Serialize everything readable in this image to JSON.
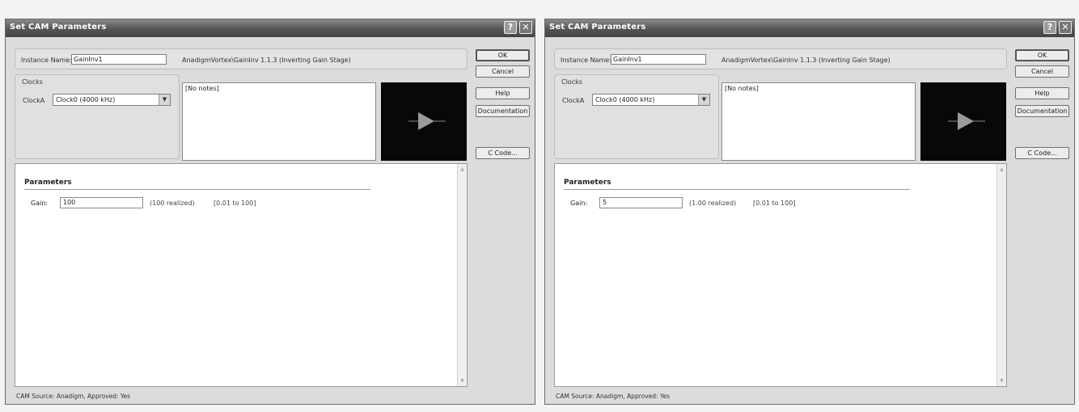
{
  "dialogs": [
    {
      "title": "Set CAM Parameters",
      "title_help": "?",
      "title_close": "✕",
      "instance_label": "Instance Name:",
      "instance_value": "GainInv1",
      "module_info": "AnadigmVortex\\GainInv 1.1.3 (Inverting Gain Stage)",
      "clocks_title": "Clocks",
      "clock_label": "ClockA",
      "clock_value": "Clock0 (4000 kHz)",
      "notes": "[No notes]",
      "buttons": {
        "ok": "OK",
        "cancel": "Cancel",
        "help": "Help",
        "documentation": "Documentation",
        "ccode": "C Code..."
      },
      "params_heading": "Parameters",
      "gain_label": "Gain:",
      "gain_value": "100",
      "gain_realized": "(100 realized)",
      "gain_range": "[0.01 to 100]",
      "status": "CAM Source: Anadigm, Approved: Yes",
      "preview_icon": "triangle-amplifier-icon"
    },
    {
      "title": "Set CAM Parameters",
      "title_help": "?",
      "title_close": "✕",
      "instance_label": "Instance Name:",
      "instance_value": "GainInv1",
      "module_info": "AnadigmVortex\\GainInv 1.1.3 (Inverting Gain Stage)",
      "clocks_title": "Clocks",
      "clock_label": "ClockA",
      "clock_value": "Clock0 (4000 kHz)",
      "notes": "[No notes]",
      "buttons": {
        "ok": "OK",
        "cancel": "Cancel",
        "help": "Help",
        "documentation": "Documentation",
        "ccode": "C Code..."
      },
      "params_heading": "Parameters",
      "gain_label": "Gain:",
      "gain_value": "5",
      "gain_realized": "(1.00 realized)",
      "gain_range": "[0.01 to 100]",
      "status": "CAM Source: Anadigm, Approved: Yes",
      "preview_icon": "triangle-amplifier-icon"
    }
  ]
}
